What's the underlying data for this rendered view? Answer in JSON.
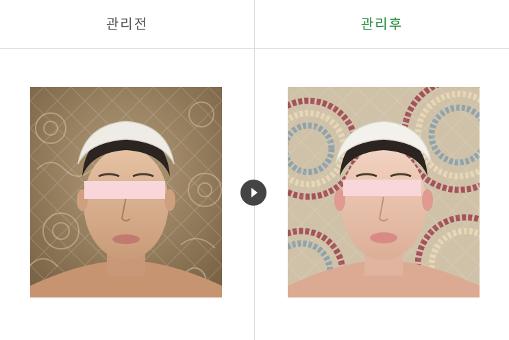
{
  "before": {
    "label": "관리전",
    "label_color": "#555555"
  },
  "after": {
    "label": "관리후",
    "label_color": "#1f8a3a"
  },
  "next_button": {
    "icon": "play-arrow-icon",
    "color": "#444444"
  },
  "censor_bar_color": "#f8d6da"
}
